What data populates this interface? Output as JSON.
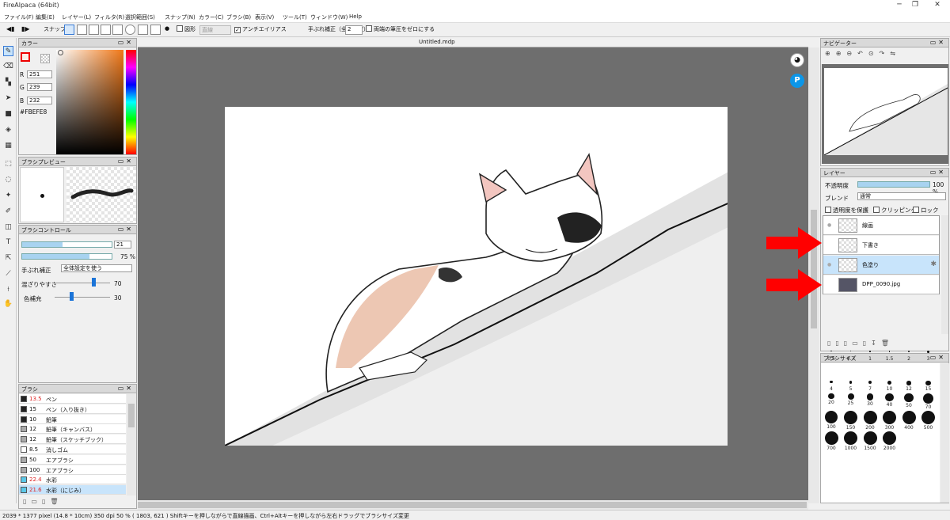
{
  "window": {
    "title": "FireAlpaca (64bit)",
    "controls": [
      "─",
      "❐",
      "✕"
    ]
  },
  "menu": [
    "ファイル(F)",
    "編集(E)",
    "レイヤー(L)",
    "フィルタ(R)",
    "選択範囲(S)",
    "スナップ(N)",
    "カラー(C)",
    "ブラシ(B)",
    "表示(V)",
    "ツール(T)",
    "ウィンドウ(W)",
    "Help"
  ],
  "toolbar": {
    "snap": "スナップ",
    "shape": "図形",
    "shape_mode": "直線",
    "antialias": "アンチエイリアス",
    "stabilizer": "手ぶれ補正（全体設定）",
    "stabilizer_value": "2",
    "pressure": "両端の筆圧をゼロにする"
  },
  "color_panel": {
    "title": "カラー",
    "r_label": "R",
    "r": "251",
    "g_label": "G",
    "g": "239",
    "b_label": "B",
    "b": "232",
    "hex": "#FBEFE8"
  },
  "brush_preview": {
    "title": "ブラシプレビュー"
  },
  "brush_control": {
    "title": "ブラシコントロール",
    "size": "21",
    "size_fraction": 0.45,
    "opacity": "75 %",
    "opacity_fraction": 0.75,
    "stab_label": "手ぶれ補正",
    "stab_value": "全体設定を使う",
    "mix_label": "混ざりやすさ",
    "mix_value": "70",
    "mix_fraction": 0.7,
    "fill_label": "色補充",
    "fill_value": "30",
    "fill_fraction": 0.3
  },
  "brush_list": {
    "title": "ブラシ",
    "items": [
      {
        "size": "13.5",
        "name": "ペン",
        "color": "#222222",
        "size_red": true
      },
      {
        "size": "15",
        "name": "ペン（入り抜き）",
        "color": "#222222",
        "size_red": false
      },
      {
        "size": "10",
        "name": "鉛筆",
        "color": "#222222",
        "size_red": false
      },
      {
        "size": "12",
        "name": "鉛筆（キャンバス）",
        "color": "#aaaaaa",
        "size_red": false
      },
      {
        "size": "12",
        "name": "鉛筆（スケッチブック）",
        "color": "#aaaaaa",
        "size_red": false
      },
      {
        "size": "8.5",
        "name": "消しゴム",
        "color": "#ffffff",
        "size_red": false
      },
      {
        "size": "50",
        "name": "エアブラシ",
        "color": "#aaaaaa",
        "size_red": false
      },
      {
        "size": "100",
        "name": "エアブラシ",
        "color": "#aaaaaa",
        "size_red": false
      },
      {
        "size": "22.4",
        "name": "水彩",
        "color": "#5bc8e8",
        "size_red": true
      },
      {
        "size": "21.6",
        "name": "水彩（にじみ）",
        "color": "#5bc8e8",
        "size_red": true
      }
    ]
  },
  "canvas": {
    "tab": "Untitled.mdp"
  },
  "navigator": {
    "title": "ナビゲーター"
  },
  "layers": {
    "title": "レイヤー",
    "opacity_label": "不透明度",
    "opacity": "100 %",
    "blend_label": "ブレンド",
    "blend": "通常",
    "protect": "透明度を保護",
    "clipping": "クリッピング",
    "lock": "ロック",
    "items": [
      {
        "name": "線画",
        "selected": false,
        "eye": true
      },
      {
        "name": "下書き",
        "selected": false,
        "eye": false
      },
      {
        "name": "色塗り",
        "selected": true,
        "eye": true
      },
      {
        "name": "DPP_0090.jpg",
        "selected": false,
        "eye": false
      }
    ]
  },
  "brush_sizes": {
    "title": "ブラシサイズ",
    "sizes": [
      "0.5",
      "0.7",
      "1",
      "1.5",
      "2",
      "3",
      "4",
      "5",
      "7",
      "10",
      "12",
      "15",
      "20",
      "25",
      "30",
      "40",
      "50",
      "70",
      "100",
      "150",
      "200",
      "300",
      "400",
      "500",
      "700",
      "1000",
      "1500",
      "2000"
    ]
  },
  "status": "2039 * 1377 pixel   (14.8 * 10cm)   350 dpi   50 %   ( 1803, 621 )   Shiftキーを押しながらで直線描画、Ctrl+Altキーを押しながら左右ドラッグでブラシサイズ変更",
  "colors": {
    "accent": "#a8d3f0",
    "arrow": "#ff0000",
    "canvas_bg": "#6e6e6e"
  }
}
